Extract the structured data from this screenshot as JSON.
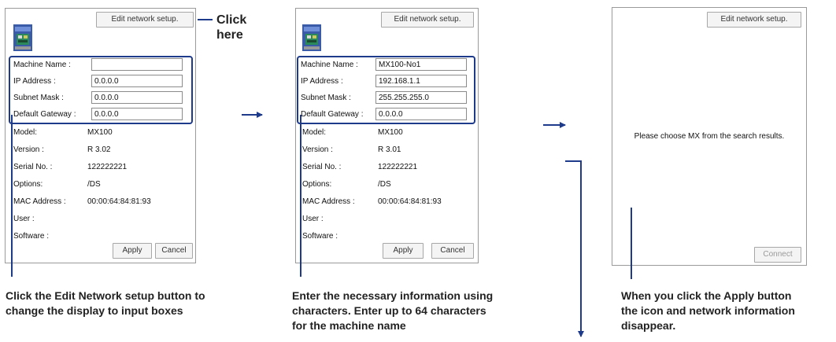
{
  "panels": [
    {
      "edit_button": "Edit network setup.",
      "fields": [
        {
          "label": "Machine Name :",
          "value": ""
        },
        {
          "label": "IP Address :",
          "value": "0.0.0.0"
        },
        {
          "label": "Subnet Mask :",
          "value": "0.0.0.0"
        },
        {
          "label": "Default Gateway :",
          "value": "0.0.0.0"
        }
      ],
      "info": [
        {
          "label": "Model:",
          "value": "MX100"
        },
        {
          "label": "Version :",
          "value": "R 3.02"
        },
        {
          "label": "Serial No. :",
          "value": "122222221"
        },
        {
          "label": "Options:",
          "value": "/DS"
        },
        {
          "label": "MAC Address :",
          "value": "00:00:64:84:81:93"
        },
        {
          "label": "User :",
          "value": ""
        },
        {
          "label": "Software :",
          "value": ""
        }
      ],
      "apply_button": "Apply",
      "cancel_button": "Cancel"
    },
    {
      "edit_button": "Edit network setup.",
      "fields": [
        {
          "label": "Machine Name :",
          "value": "MX100-No1"
        },
        {
          "label": "IP Address :",
          "value": "192.168.1.1"
        },
        {
          "label": "Subnet Mask :",
          "value": "255.255.255.0"
        },
        {
          "label": "Default Gateway :",
          "value": "0.0.0.0"
        }
      ],
      "info": [
        {
          "label": "Model:",
          "value": "MX100"
        },
        {
          "label": "Version :",
          "value": "R 3.01"
        },
        {
          "label": "Serial No. :",
          "value": "122222221"
        },
        {
          "label": "Options:",
          "value": "/DS"
        },
        {
          "label": "MAC Address :",
          "value": "00:00:64:84:81:93"
        },
        {
          "label": "User :",
          "value": ""
        },
        {
          "label": "Software :",
          "value": ""
        }
      ],
      "apply_button": "Apply",
      "cancel_button": "Cancel"
    },
    {
      "edit_button": "Edit network setup.",
      "message": "Please choose MX from the search results.",
      "connect_button": "Connect"
    }
  ],
  "callout": {
    "line1": "Click",
    "line2": "here"
  },
  "captions": {
    "left": [
      "Click the Edit Network setup button to",
      "change the display to input boxes"
    ],
    "middle": [
      "Enter the necessary information using",
      "characters.  Enter up to 64 characters",
      "for the machine name"
    ],
    "right": [
      "When you click the Apply button",
      "the icon and network information",
      "disappear."
    ]
  },
  "colors": {
    "accent": "#1e3a8a",
    "panel_border": "#9a9a9a"
  }
}
